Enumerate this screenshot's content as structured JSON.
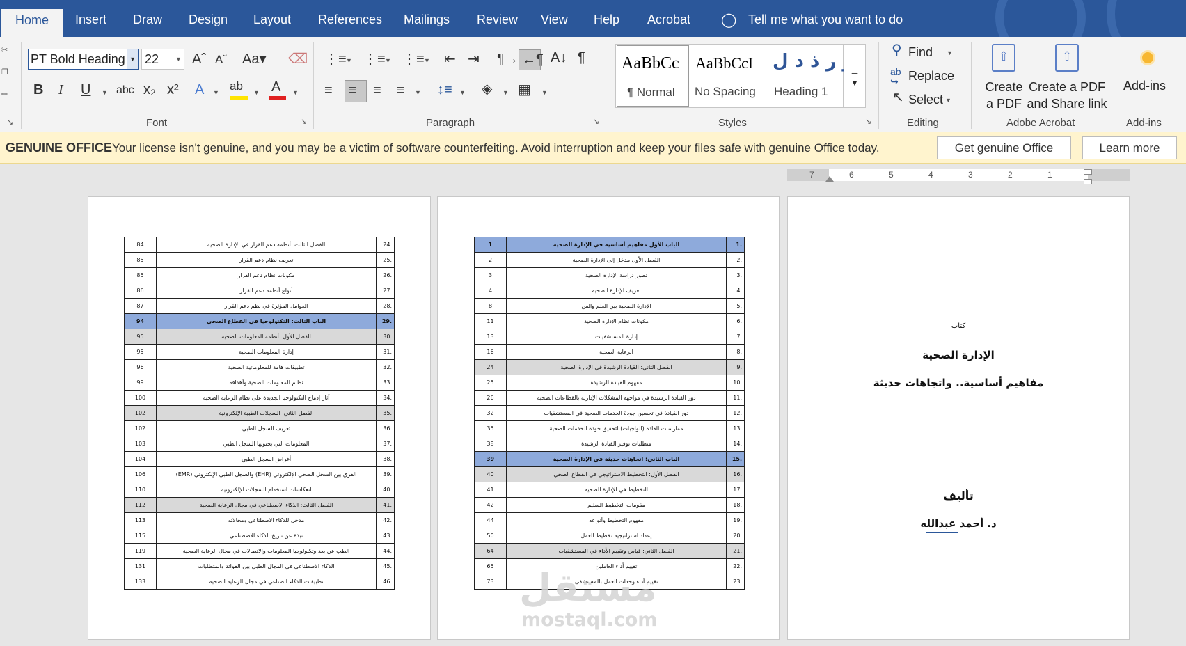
{
  "tabs": [
    "Home",
    "Insert",
    "Draw",
    "Design",
    "Layout",
    "References",
    "Mailings",
    "Review",
    "View",
    "Help",
    "Acrobat"
  ],
  "tell_me": "Tell me what you want to do",
  "font": {
    "name": "PT Bold Heading",
    "size": "22",
    "group": "Font"
  },
  "paragraph": {
    "group": "Paragraph"
  },
  "styles": {
    "group": "Styles",
    "items": [
      {
        "preview": "AaBbCc",
        "label": "¶ Normal"
      },
      {
        "preview": "AaBbCcI",
        "label": "No Spacing"
      },
      {
        "preview": "ز ر ذ د ل",
        "label": "Heading 1"
      }
    ]
  },
  "editing": {
    "group": "Editing",
    "find": "Find",
    "replace": "Replace",
    "select": "Select"
  },
  "acrobat": {
    "group": "Adobe Acrobat",
    "create_pdf": [
      "Create",
      "a PDF"
    ],
    "create_share": [
      "Create a PDF",
      "and Share link"
    ]
  },
  "addins": {
    "label": "Add-ins",
    "group": "Add-ins"
  },
  "banner": {
    "title": "GENUINE OFFICE",
    "message": "Your license isn't genuine, and you may be a victim of software counterfeiting. Avoid interruption and keep your files safe with genuine Office today.",
    "btn_get": "Get genuine Office",
    "btn_learn": "Learn more"
  },
  "ruler": {
    "labels": [
      "7",
      "6",
      "5",
      "4",
      "3",
      "2",
      "1"
    ]
  },
  "toc_page1": [
    {
      "num": ".24",
      "title": "الفصل الثالث: أنظمة دعم القرار في الإدارة الصحية",
      "page": "84",
      "style": ""
    },
    {
      "num": ".25",
      "title": "تعريف نظام دعم القرار",
      "page": "85",
      "style": ""
    },
    {
      "num": ".26",
      "title": "مكونات نظام دعم القرار",
      "page": "85",
      "style": ""
    },
    {
      "num": ".27",
      "title": "أنواع أنظمة دعم القرار",
      "page": "86",
      "style": ""
    },
    {
      "num": ".28",
      "title": "العوامل المؤثرة في نظم دعم القرار",
      "page": "87",
      "style": ""
    },
    {
      "num": ".29",
      "title": "الباب الثالث: التكنولوجيا في القطاع الصحي",
      "page": "94",
      "style": "blue"
    },
    {
      "num": ".30",
      "title": "الفصل الأول: أنظمة المعلومات الصحية",
      "page": "95",
      "style": "gray"
    },
    {
      "num": ".31",
      "title": "إدارة المعلومات الصحية",
      "page": "95",
      "style": ""
    },
    {
      "num": ".32",
      "title": "تطبيقات هامة للمعلوماتية الصحية",
      "page": "96",
      "style": ""
    },
    {
      "num": ".33",
      "title": "نظام المعلومات الصحية وأهدافه",
      "page": "99",
      "style": ""
    },
    {
      "num": ".34",
      "title": "آثار إدماج التكنولوجيا الجديدة على نظام الرعاية الصحية",
      "page": "100",
      "style": ""
    },
    {
      "num": ".35",
      "title": "الفصل الثاني: السجلات الطبية الإلكترونية",
      "page": "102",
      "style": "gray"
    },
    {
      "num": ".36",
      "title": "تعريف السجل الطبي",
      "page": "102",
      "style": ""
    },
    {
      "num": ".37",
      "title": "المعلومات التي يحتويها السجل الطبي",
      "page": "103",
      "style": ""
    },
    {
      "num": ".38",
      "title": "أغراض السجل الطبي",
      "page": "104",
      "style": ""
    },
    {
      "num": ".39",
      "title": "الفرق بين السجل الصحي الإلكتروني (EHR) والسجل الطبي الإلكتروني (EMR)",
      "page": "106",
      "style": ""
    },
    {
      "num": ".40",
      "title": "انعكاسات استخدام السجلات الإلكترونية",
      "page": "110",
      "style": ""
    },
    {
      "num": ".41",
      "title": "الفصل الثالث: الذكاء الاصطناعي في مجال الرعاية الصحية",
      "page": "112",
      "style": "gray"
    },
    {
      "num": ".42",
      "title": "مدخل للذكاء الاصطناعي ومجالاته",
      "page": "113",
      "style": ""
    },
    {
      "num": ".43",
      "title": "نبذة عن تاريخ الذكاء الاصطناعي",
      "page": "115",
      "style": ""
    },
    {
      "num": ".44",
      "title": "الطب عن بعد وتكنولوجيا المعلومات والاتصالات في مجال الرعاية الصحية",
      "page": "119",
      "style": ""
    },
    {
      "num": ".45",
      "title": "الذكاء الاصطناعي في المجال الطبي بين الفوائد والمتطلبات",
      "page": "131",
      "style": ""
    },
    {
      "num": ".46",
      "title": "تطبيقات الذكاء الصناعي في مجال الرعاية الصحية",
      "page": "133",
      "style": ""
    }
  ],
  "toc_page2": [
    {
      "num": ".1",
      "title": "الباب الأول مفاهيم أساسية في الإدارة الصحية",
      "page": "1",
      "style": "blue"
    },
    {
      "num": ".2",
      "title": "الفصل الأول مدخل إلى الإدارة الصحية",
      "page": "2",
      "style": ""
    },
    {
      "num": ".3",
      "title": "تطور دراسة الإدارة الصحية",
      "page": "3",
      "style": ""
    },
    {
      "num": ".4",
      "title": "تعريف الإدارة الصحية",
      "page": "4",
      "style": ""
    },
    {
      "num": ".5",
      "title": "الإدارة الصحية بين العلم والفن",
      "page": "8",
      "style": ""
    },
    {
      "num": ".6",
      "title": "مكونات نظام الإدارة الصحية",
      "page": "11",
      "style": ""
    },
    {
      "num": ".7",
      "title": "إدارة المستشفيات",
      "page": "13",
      "style": ""
    },
    {
      "num": ".8",
      "title": "الرعاية الصحية",
      "page": "16",
      "style": ""
    },
    {
      "num": ".9",
      "title": "الفصل الثاني: القيادة الرشيدة في الإدارة الصحية",
      "page": "24",
      "style": "gray"
    },
    {
      "num": ".10",
      "title": "مفهوم القيادة الرشيدة",
      "page": "25",
      "style": ""
    },
    {
      "num": ".11",
      "title": "دور القيادة الرشيدة في مواجهة المشكلات الإدارية بالقطاعات الصحية",
      "page": "26",
      "style": ""
    },
    {
      "num": ".12",
      "title": "دور القيادة في تحسين جودة الخدمات الصحية في المستشفيات",
      "page": "32",
      "style": ""
    },
    {
      "num": ".13",
      "title": "ممارسات القادة (الواجبات) لتحقيق جودة الخدمات الصحية",
      "page": "35",
      "style": ""
    },
    {
      "num": ".14",
      "title": "متطلبات توفير القيادة الرشيدة",
      "page": "38",
      "style": ""
    },
    {
      "num": ".15",
      "title": "الباب الثاني: اتجاهات حديثة في الإدارة الصحية",
      "page": "39",
      "style": "blue"
    },
    {
      "num": ".16",
      "title": "الفصل الأول: التخطيط الاستراتيجي في القطاع الصحي",
      "page": "40",
      "style": "gray"
    },
    {
      "num": ".17",
      "title": "التخطيط في الإدارة الصحية",
      "page": "41",
      "style": ""
    },
    {
      "num": ".18",
      "title": "مقومات التخطيط السليم",
      "page": "42",
      "style": ""
    },
    {
      "num": ".19",
      "title": "مفهوم التخطيط وأنواعه",
      "page": "44",
      "style": ""
    },
    {
      "num": ".20",
      "title": "إعداد استراتيجية تخطيط العمل",
      "page": "50",
      "style": ""
    },
    {
      "num": ".21",
      "title": "الفصل الثاني: قياس وتقييم الأداء في المستشفيات",
      "page": "64",
      "style": "gray"
    },
    {
      "num": ".22",
      "title": "تقييم أداء العاملين",
      "page": "65",
      "style": ""
    },
    {
      "num": ".23",
      "title": "تقييم أداء وحدات العمل بالمستشفى",
      "page": "73",
      "style": ""
    }
  ],
  "cover": {
    "label": "كتاب",
    "title": "الإدارة الصحية",
    "subtitle": "مفاهيم أساسية.. واتجاهات حديثة",
    "author_label": "تأليف",
    "author": "د. أحمد عبدالله"
  },
  "watermark": {
    "logo": "مستقل",
    "url": "mostaql.com"
  }
}
